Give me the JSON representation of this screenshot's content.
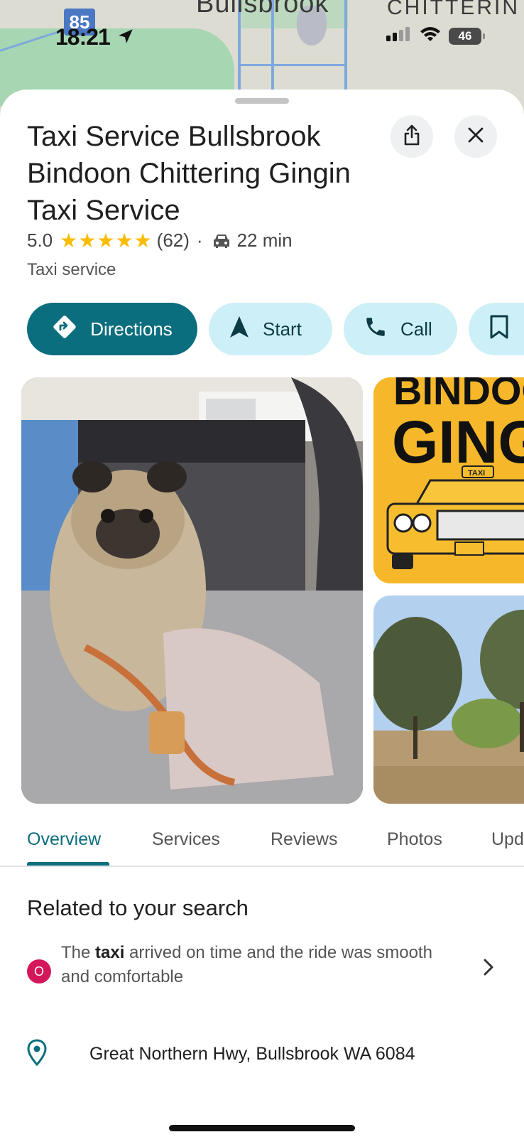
{
  "status_bar": {
    "time": "18:21",
    "battery": "46",
    "icons": [
      "location-arrow-icon",
      "cellular-signal-icon",
      "wifi-icon",
      "battery-icon"
    ]
  },
  "map": {
    "town_label": "Bullsbrook",
    "town_label_2": "CHITTERIN",
    "highway_shield": "85"
  },
  "place": {
    "title": "Taxi Service Bullsbrook Bindoon Chittering Gingin Taxi Service",
    "rating": "5.0",
    "stars": "★★★★★",
    "review_count": "(62)",
    "separator": "·",
    "drive_time": "22 min",
    "category": "Taxi service"
  },
  "actions": {
    "directions": "Directions",
    "start": "Start",
    "call": "Call"
  },
  "photos": {
    "side_top_text_1": "BINDOO",
    "side_top_text_2": "GINGI",
    "taxi_sign": "TAXI"
  },
  "tabs": [
    "Overview",
    "Services",
    "Reviews",
    "Photos",
    "Upd"
  ],
  "related": {
    "title": "Related to your search",
    "avatar_letter": "O",
    "snippet_prefix": "The ",
    "snippet_bold": "taxi",
    "snippet_suffix": " arrived on time and the ride was smooth and comfortable"
  },
  "address": "Great Northern Hwy, Bullsbrook WA 6084",
  "colors": {
    "primary": "#0b6e7e",
    "chip_secondary": "#cdf0f8",
    "star": "#fbbc04",
    "avatar": "#d3175a"
  }
}
